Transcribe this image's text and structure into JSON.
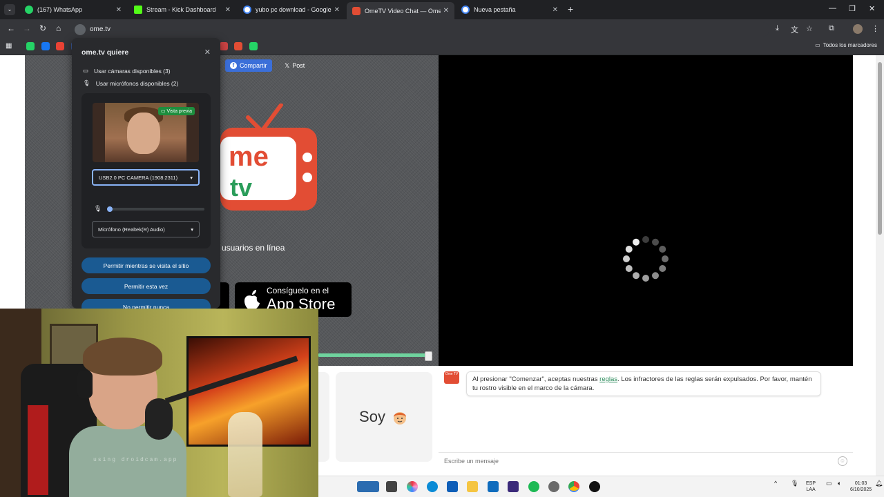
{
  "browser": {
    "tabs": [
      {
        "title": "(167) WhatsApp",
        "color": "#25d366",
        "active": false
      },
      {
        "title": "Stream - Kick Dashboard",
        "color": "#53fc18",
        "active": false
      },
      {
        "title": "yubo pc download - Google Se",
        "color": "#ffffff",
        "active": false
      },
      {
        "title": "OmeTV Video Chat — Omegle",
        "color": "#e24d34",
        "active": true
      },
      {
        "title": "Nueva pestaña",
        "color": "#ffffff",
        "active": false
      }
    ],
    "url": "ome.tv",
    "bookmarks_folder": "Todos los marcadores",
    "bookmark_colors": [
      "#25d366",
      "#1877f2",
      "#ea4335",
      "#3b5998",
      "#0fa",
      "#555",
      "#fa2d48",
      "#ddd",
      "#1da1f2",
      "#333",
      "#555",
      "#111",
      "#1da1f2",
      "#c44",
      "#e24d34",
      "#25d366"
    ]
  },
  "page": {
    "share_label": "Compartir",
    "post_label": "Post",
    "online_text": "usuarios en línea",
    "appstore": {
      "line1": "Consíguelo en el",
      "line2": "App Store"
    },
    "soy_label": "Soy",
    "chat": {
      "logo_text": "Ome TV",
      "notice_before": "Al presionar \"Comenzar\", aceptas nuestras",
      "rules_link": "reglas",
      "notice_after": ". Los infractores de las reglas serán expulsados. Por favor, mantén tu rostro visible en el marco de la cámara.",
      "placeholder": "Escribe un mensaje"
    }
  },
  "permission": {
    "title": "ome.tv quiere",
    "cameras": "Usar cámaras disponibles (3)",
    "microphones": "Usar micrófonos disponibles (2)",
    "preview_badge": "Vista previa",
    "camera_select": "USB2.0 PC CAMERA (1908:2311)",
    "mic_select": "Micrófono (Realtek(R) Audio)",
    "mic_level": 0,
    "buttons": {
      "allow_visit": "Permitir mientras se visita el sitio",
      "allow_once": "Permitir esta vez",
      "never": "No permitir nunca"
    }
  },
  "webcam": {
    "watermark": "using droidcam.app"
  },
  "taskbar": {
    "lang_top": "ESP",
    "lang_bottom": "LAA",
    "time": "01:03",
    "date": "6/10/2025"
  }
}
